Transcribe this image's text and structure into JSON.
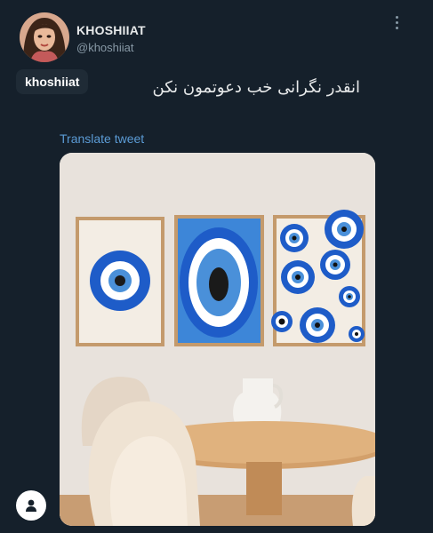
{
  "author": {
    "display_name": "KHOSHIIAT",
    "handle": "@khoshiiat"
  },
  "tag_label": "khoshiiat",
  "tweet_text": "انقدر نگرانی خب دعوتمون نکن",
  "translate_label": "Translate tweet",
  "icons": {
    "more": "more-vertical-icon",
    "profile": "user-icon"
  },
  "colors": {
    "background": "#15202b",
    "link": "#5b9bd5",
    "eye_blue": "#1e5cc8"
  }
}
